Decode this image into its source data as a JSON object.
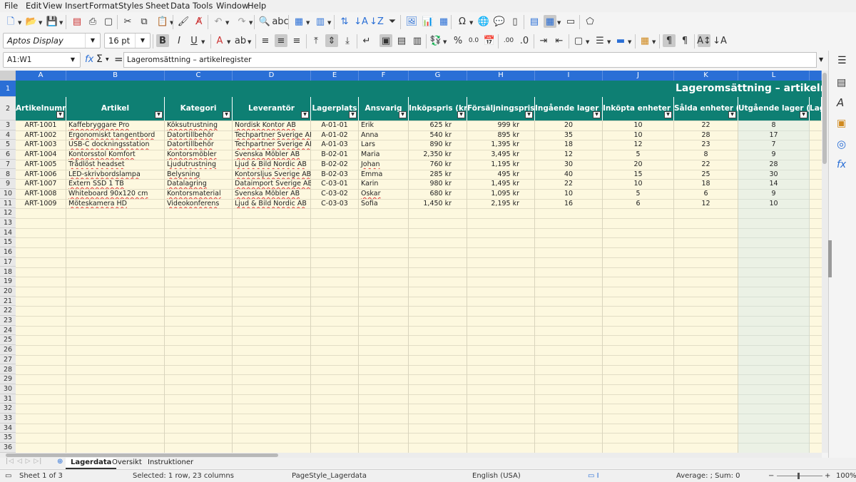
{
  "menu": [
    "File",
    "Edit",
    "View",
    "Insert",
    "Format",
    "Styles",
    "Sheet",
    "Data",
    "Tools",
    "Window",
    "Help"
  ],
  "toolbar2": {
    "font_name": "Aptos Display",
    "font_size": "16 pt"
  },
  "formula": {
    "name_box": "A1:W1",
    "content": "Lageromsättning – artikelregister"
  },
  "columns": [
    "A",
    "B",
    "C",
    "D",
    "E",
    "F",
    "G",
    "H",
    "I",
    "J",
    "K",
    "L"
  ],
  "title_text": "Lageromsättning – artikelregister",
  "headers": [
    "Artikelnummer",
    "Artikel",
    "Kategori",
    "Leverantör",
    "Lagerplats",
    "Ansvarig",
    "Inköpspris (kr)",
    "Försäljningspris (kr)",
    "Ingående lager (antal)",
    "Inköpta enheter (antal)",
    "Sålda enheter (antal)",
    "Utgående lager (antal)",
    "Lageromsättning"
  ],
  "rows": [
    [
      "ART-1001",
      "Kaffebryggare Pro",
      "Köksutrustning",
      "Nordisk Kontor AB",
      "A-01-01",
      "Erik",
      "625 kr",
      "999 kr",
      "20",
      "10",
      "22",
      "8"
    ],
    [
      "ART-1002",
      "Ergonomiskt tangentbord",
      "Datortillbehör",
      "Techpartner Sverige AB",
      "A-01-02",
      "Anna",
      "540 kr",
      "895 kr",
      "35",
      "10",
      "28",
      "17"
    ],
    [
      "ART-1003",
      "USB-C dockningsstation",
      "Datortillbehör",
      "Techpartner Sverige AB",
      "A-01-03",
      "Lars",
      "890 kr",
      "1,395 kr",
      "18",
      "12",
      "23",
      "7"
    ],
    [
      "ART-1004",
      "Kontorsstol Komfort",
      "Kontorsmöbler",
      "Svenska Möbler AB",
      "B-02-01",
      "Maria",
      "2,350 kr",
      "3,495 kr",
      "12",
      "5",
      "8",
      "9"
    ],
    [
      "ART-1005",
      "Trådlöst headset",
      "Ljudutrustning",
      "Ljud & Bild Nordic AB",
      "B-02-02",
      "Johan",
      "760 kr",
      "1,195 kr",
      "30",
      "20",
      "22",
      "28"
    ],
    [
      "ART-1006",
      "LED-skrivbordslampa",
      "Belysning",
      "Kontorsljus Sverige AB",
      "B-02-03",
      "Emma",
      "285 kr",
      "495 kr",
      "40",
      "15",
      "25",
      "30"
    ],
    [
      "ART-1007",
      "Extern SSD 1 TB",
      "Datalagring",
      "Dataimport Sverige AB",
      "C-03-01",
      "Karin",
      "980 kr",
      "1,495 kr",
      "22",
      "10",
      "18",
      "14"
    ],
    [
      "ART-1008",
      "Whiteboard 90x120 cm",
      "Kontorsmaterial",
      "Svenska Möbler AB",
      "C-03-02",
      "Oskar",
      "680 kr",
      "1,095 kr",
      "10",
      "5",
      "6",
      "9"
    ],
    [
      "ART-1009",
      "Möteskamera HD",
      "Videokonferens",
      "Ljud & Bild Nordic AB",
      "C-03-03",
      "Sofia",
      "1,450 kr",
      "2,195 kr",
      "16",
      "6",
      "12",
      "10"
    ]
  ],
  "row_numbers": [
    "1",
    "2",
    "3",
    "4",
    "5",
    "6",
    "7",
    "8",
    "9",
    "10",
    "11",
    "12",
    "13",
    "14",
    "15",
    "16",
    "17",
    "18",
    "19",
    "20",
    "21",
    "22",
    "23",
    "24",
    "25",
    "26",
    "27",
    "28",
    "29",
    "30",
    "31",
    "32",
    "33",
    "34",
    "35",
    "36"
  ],
  "sheet_tabs": [
    "Lagerdata",
    "Oversikt",
    "Instruktioner"
  ],
  "status": {
    "sheet": "Sheet 1 of 3",
    "selection": "Selected: 1 row, 23 columns",
    "page_style": "PageStyle_Lagerdata",
    "language": "English (USA)",
    "sum": "Average: ; Sum: 0",
    "zoom": "100%"
  },
  "colors": {
    "header_teal": "#0e7f73",
    "cell_bg": "#fdf8df",
    "selection_blue": "#2a6fd6"
  }
}
